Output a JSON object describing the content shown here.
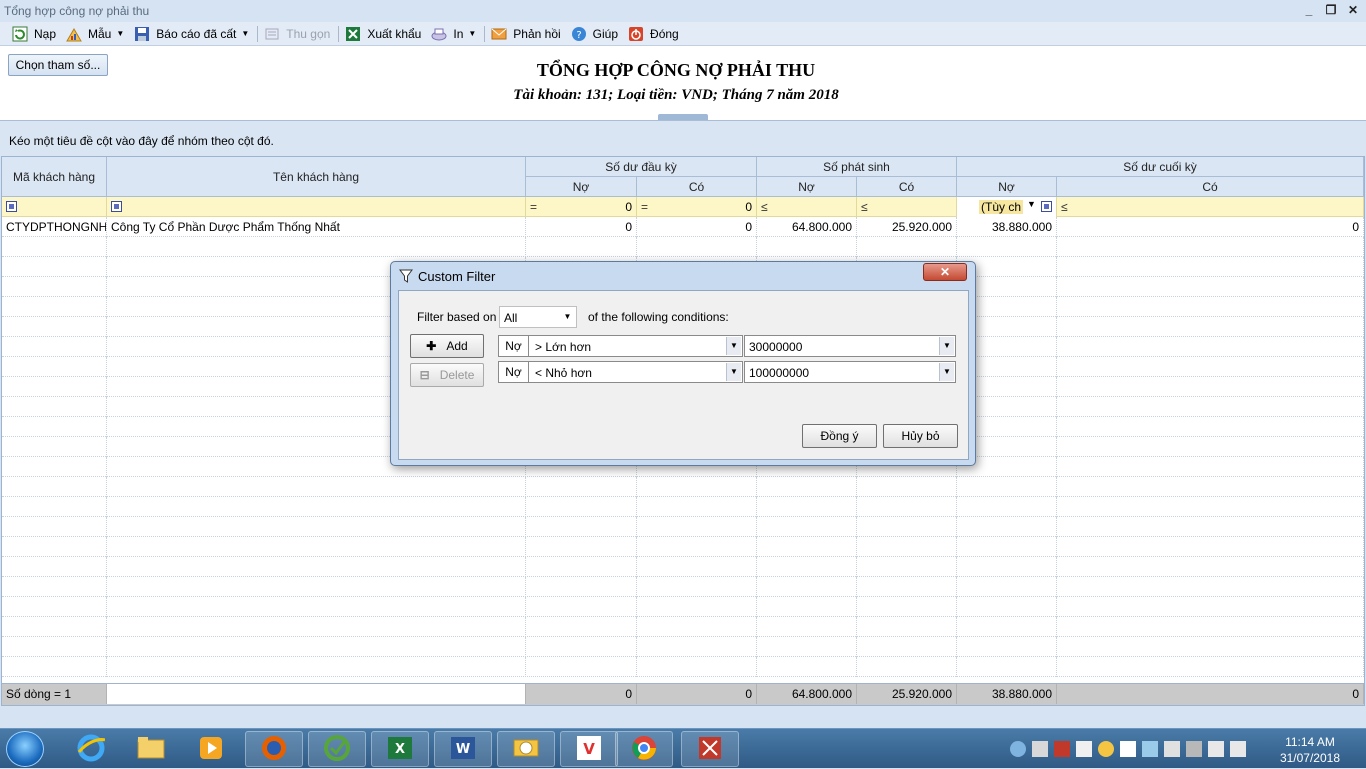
{
  "window": {
    "title": "Tổng hợp công nợ phải thu"
  },
  "toolbar": {
    "items": [
      {
        "label": "Nạp",
        "icon": "refresh-icon"
      },
      {
        "label": "Mẫu",
        "icon": "chart-icon"
      },
      {
        "label": "Báo cáo đã cất",
        "icon": "save-icon"
      },
      {
        "label": "Thu gọn",
        "icon": "collapse-icon"
      },
      {
        "label": "Xuất khẩu",
        "icon": "excel-icon"
      },
      {
        "label": "In",
        "icon": "printer-icon"
      },
      {
        "label": "Phản hồi",
        "icon": "mail-icon"
      },
      {
        "label": "Giúp",
        "icon": "help-icon"
      },
      {
        "label": "Đóng",
        "icon": "power-icon"
      }
    ]
  },
  "params_button": "Chọn tham số...",
  "report": {
    "title": "TỔNG HỢP CÔNG NỢ PHẢI THU",
    "subtitle": "Tài khoản: 131; Loại tiền: VND; Tháng 7 năm 2018"
  },
  "group_panel": "Kéo một tiêu đề cột vào đây để nhóm theo cột đó.",
  "grid": {
    "headers": {
      "ma_kh": "Mã khách hàng",
      "ten_kh": "Tên khách hàng",
      "dau_ky": "Số dư đầu kỳ",
      "phat_sinh": "Số phát sinh",
      "cuoi_ky": "Số dư cuối kỳ",
      "no": "Nợ",
      "co": "Có"
    },
    "filter": {
      "dau_no_op": "=",
      "dau_no_val": "0",
      "dau_co_op": "=",
      "dau_co_val": "0",
      "ps_no_op": "≤",
      "ps_co_op": "≤",
      "ck_no_val": "(Tùy ch",
      "ck_co_op": "≤"
    },
    "rows": [
      {
        "ma": "CTYDPTHONGNH",
        "ten": "Công Ty Cổ Phần Dược Phẩm Thống Nhất",
        "dau_no": "0",
        "dau_co": "0",
        "ps_no": "64.800.000",
        "ps_co": "25.920.000",
        "ck_no": "38.880.000",
        "ck_co": "0"
      }
    ],
    "footer": {
      "label": "Số dòng = 1",
      "dau_no": "0",
      "dau_co": "0",
      "ps_no": "64.800.000",
      "ps_co": "25.920.000",
      "ck_no": "38.880.000",
      "ck_co": "0"
    }
  },
  "dialog": {
    "title": "Custom Filter",
    "close": "✕",
    "filter_based_label": "Filter based on",
    "filter_based_value": "All",
    "conditions_label": "of the following conditions:",
    "add": "Add",
    "delete": "Delete",
    "conditions": [
      {
        "column": "Nợ",
        "operator": ">  Lớn hơn",
        "value": "30000000"
      },
      {
        "column": "Nợ",
        "operator": "<  Nhỏ hơn",
        "value": "100000000"
      }
    ],
    "ok": "Đồng ý",
    "cancel": "Hủy bỏ"
  },
  "taskbar": {
    "time": "11:14 AM",
    "date": "31/07/2018",
    "apps": [
      "ie-icon",
      "explorer-icon",
      "media-player-icon",
      "firefox-icon",
      "app-green-icon",
      "excel-icon",
      "word-icon",
      "outlook-icon",
      "vnc-icon",
      "chrome-icon",
      "misa-icon"
    ]
  },
  "colors": {
    "accent": "#d6e3f2",
    "filter_row": "#fdf6c7",
    "taskbar": "#2f5a85"
  }
}
